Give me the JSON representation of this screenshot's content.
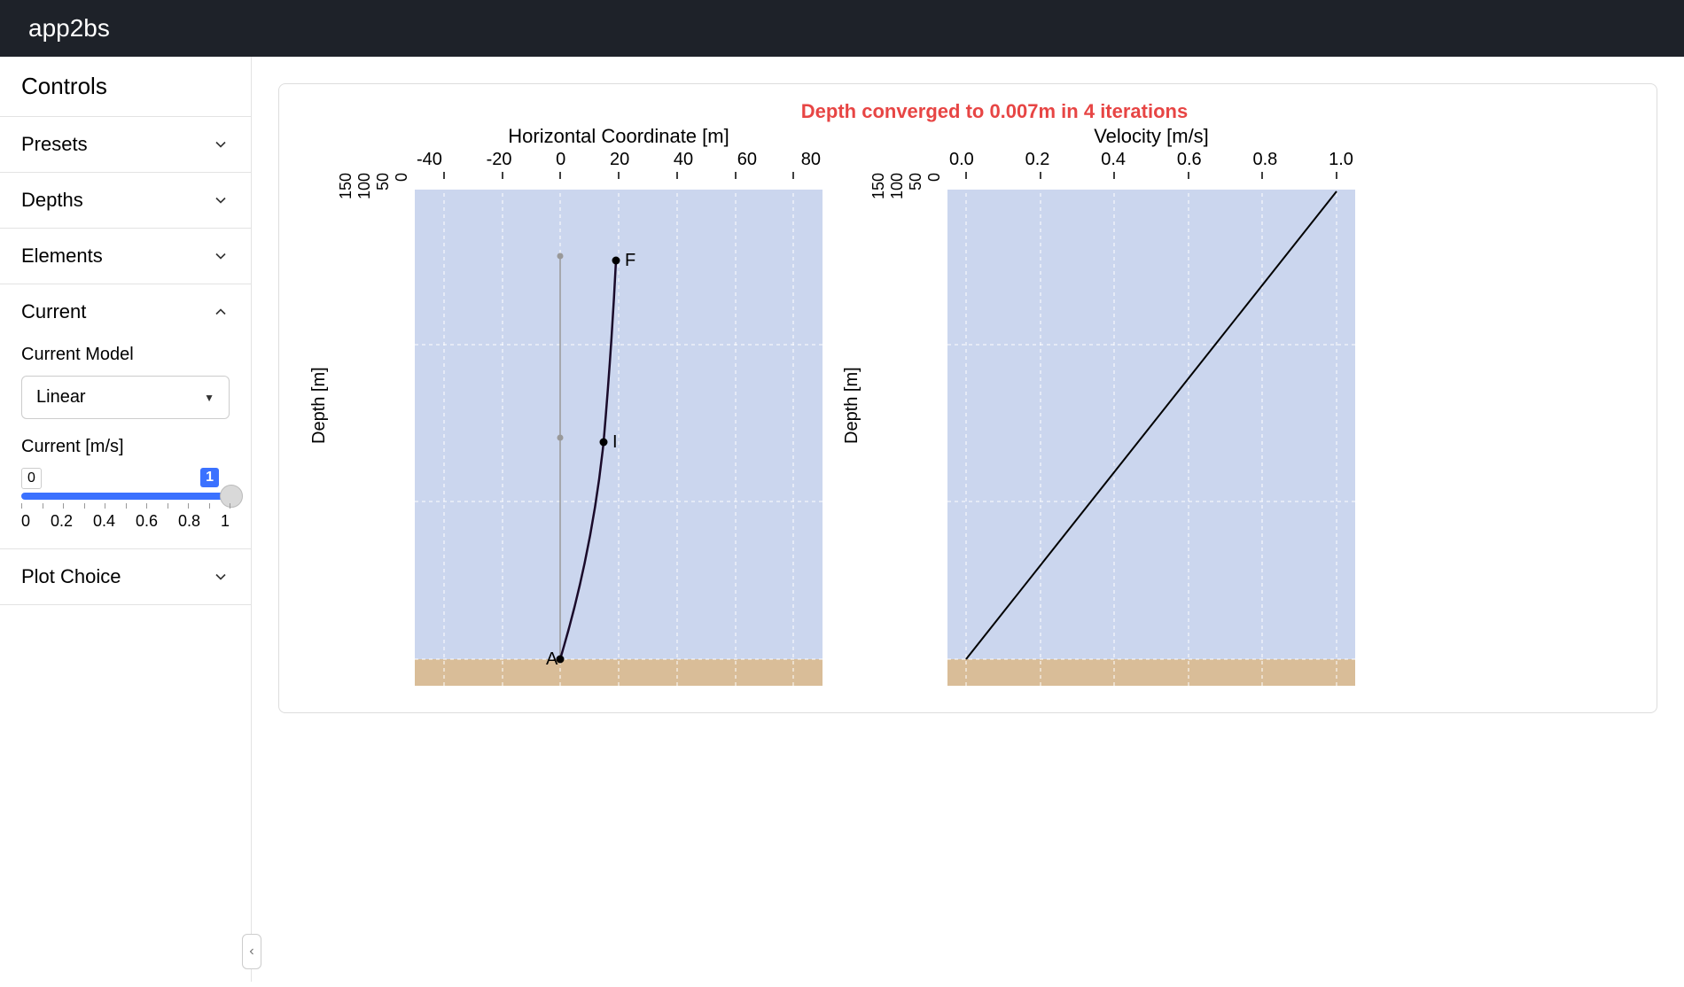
{
  "header": {
    "title": "app2bs"
  },
  "sidebar": {
    "title": "Controls",
    "items": [
      {
        "label": "Presets",
        "expanded": false
      },
      {
        "label": "Depths",
        "expanded": false
      },
      {
        "label": "Elements",
        "expanded": false
      },
      {
        "label": "Current",
        "expanded": true
      },
      {
        "label": "Plot Choice",
        "expanded": false
      }
    ],
    "current": {
      "model_label": "Current Model",
      "model_value": "Linear",
      "slider_label": "Current [m/s]",
      "slider_min_display": "0",
      "slider_max_display": "1",
      "slider_value": 1,
      "slider_ticks": [
        "0",
        "0.2",
        "0.4",
        "0.6",
        "0.8",
        "1"
      ]
    }
  },
  "chart": {
    "status": "Depth converged to 0.007m in 4 iterations",
    "left": {
      "xlabel": "Horizontal Coordinate [m]",
      "ylabel": "Depth [m]",
      "xticks": [
        "-40",
        "-20",
        "0",
        "20",
        "40",
        "60",
        "80"
      ],
      "yticks": [
        "0",
        "50",
        "100",
        "150"
      ]
    },
    "right": {
      "xlabel": "Velocity [m/s]",
      "ylabel": "Depth [m]",
      "xticks": [
        "0.0",
        "0.2",
        "0.4",
        "0.6",
        "0.8",
        "1.0"
      ],
      "yticks": [
        "0",
        "50",
        "100",
        "150"
      ]
    },
    "points": {
      "F": "F",
      "I": "I",
      "A": "A"
    }
  },
  "chart_data": [
    {
      "type": "line",
      "title": "Depth converged to 0.007m in 4 iterations",
      "xlabel": "Horizontal Coordinate [m]",
      "ylabel": "Depth [m]",
      "xlim": [
        -50,
        90
      ],
      "ylim": [
        160,
        -5
      ],
      "series": [
        {
          "name": "mooring-line",
          "x": [
            0,
            7,
            12,
            15,
            17,
            18,
            19
          ],
          "y": [
            145,
            120,
            90,
            70,
            50,
            35,
            22
          ]
        },
        {
          "name": "reference-vertical",
          "x": [
            0,
            0
          ],
          "y": [
            145,
            22
          ]
        }
      ],
      "annotations": [
        {
          "label": "A",
          "x": 0,
          "y": 145
        },
        {
          "label": "I",
          "x": 15,
          "y": 80
        },
        {
          "label": "F",
          "x": 19,
          "y": 22
        }
      ],
      "regions": {
        "water": {
          "y_range": [
            5,
            145
          ],
          "color": "#cbd6ee"
        },
        "seabed": {
          "y_range": [
            145,
            160
          ],
          "color": "#d9bd98"
        }
      }
    },
    {
      "type": "line",
      "xlabel": "Velocity [m/s]",
      "ylabel": "Depth [m]",
      "xlim": [
        -0.05,
        1.05
      ],
      "ylim": [
        160,
        -5
      ],
      "series": [
        {
          "name": "velocity-profile-linear",
          "x": [
            0.0,
            1.0
          ],
          "y": [
            145,
            5
          ]
        }
      ],
      "regions": {
        "water": {
          "y_range": [
            5,
            145
          ],
          "color": "#cbd6ee"
        },
        "seabed": {
          "y_range": [
            145,
            160
          ],
          "color": "#d9bd98"
        }
      }
    }
  ]
}
